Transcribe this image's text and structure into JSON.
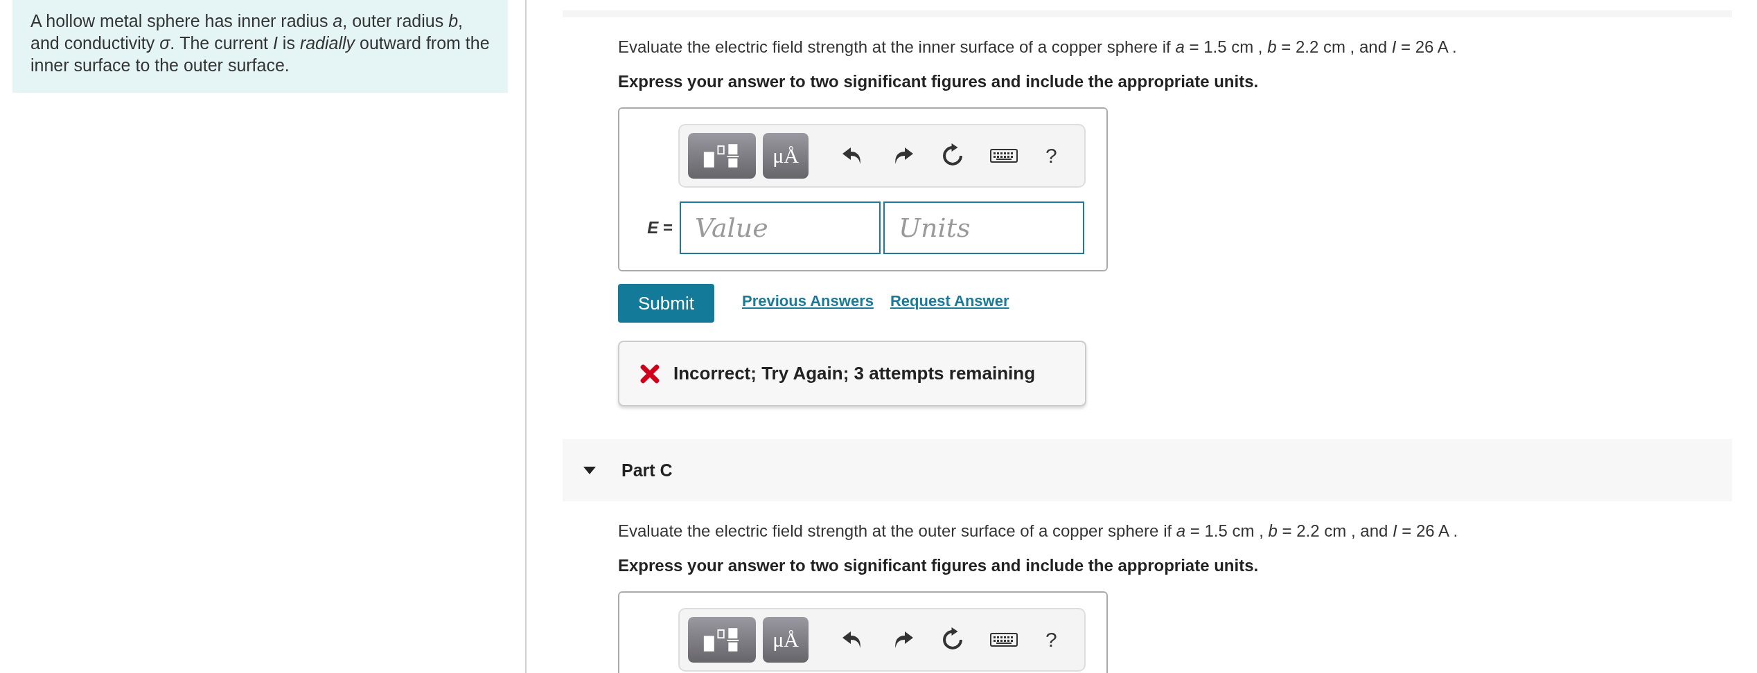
{
  "intro": {
    "text": "A hollow metal sphere has inner radius *a*, outer radius *b*, and conductivity *σ*. The current *I* is *radially* outward from the inner surface to the outer surface."
  },
  "parts": [
    {
      "question": "Evaluate the electric field strength at the inner surface of a copper sphere if *a* = 1.5 cm , *b* = 2.2 cm , and *I* = 26 A .",
      "instruction": "Express your answer to two significant figures and include the appropriate units.",
      "toolbar": {
        "units_button": "μÅ",
        "help": "?"
      },
      "answer": {
        "label": "*E* =",
        "value_placeholder": "Value",
        "units_placeholder": "Units"
      },
      "actions": {
        "submit": "Submit",
        "links": [
          "Previous Answers",
          "Request Answer"
        ]
      },
      "feedback": {
        "kind": "incorrect",
        "text": "Incorrect; Try Again; 3 attempts remaining"
      }
    },
    {
      "title": "Part C",
      "expanded": true,
      "question": "Evaluate the electric field strength at the outer surface of a copper sphere if *a* = 1.5 cm , *b* = 2.2 cm , and *I* = 26 A .",
      "instruction": "Express your answer to two significant figures and include the appropriate units.",
      "toolbar": {
        "units_button": "μÅ",
        "help": "?"
      }
    }
  ]
}
